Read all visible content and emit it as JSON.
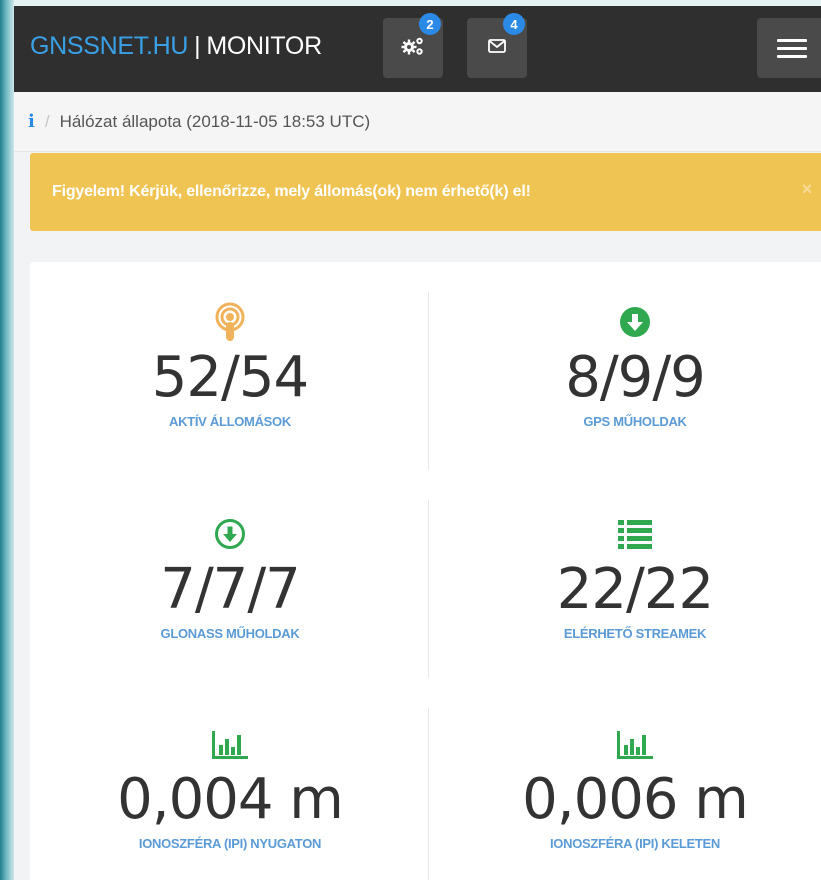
{
  "header": {
    "site": "GNSSNET.HU",
    "separator": "|",
    "app_name": "MONITOR",
    "tasks_badge": "2",
    "mail_badge": "4"
  },
  "breadcrumb": {
    "info_glyph": "i",
    "slash": "/",
    "page": "Hálózat állapota (2018-11-05 18:53 UTC)"
  },
  "alert": {
    "text": "Figyelem! Kérjük, ellenőrizze, mely állomás(ok) nem érhető(k) el!",
    "close": "×"
  },
  "stats": [
    {
      "value": "52/54",
      "label": "AKTÍV ÁLLOMÁSOK",
      "icon": "podcast-icon",
      "icon_color": "#f0b35b"
    },
    {
      "value": "8/9/9",
      "label": "GPS MŰHOLDAK",
      "icon": "arrow-circle-down-icon",
      "icon_color": "#2fa84f"
    },
    {
      "value": "7/7/7",
      "label": "GLONASS MŰHOLDAK",
      "icon": "arrow-circle-down-outline-icon",
      "icon_color": "#2fa84f"
    },
    {
      "value": "22/22",
      "label": "ELÉRHETŐ STREAMEK",
      "icon": "list-icon",
      "icon_color": "#2fa84f"
    },
    {
      "value": "0,004 m",
      "label": "IONOSZFÉRA (IPI) NYUGATON",
      "icon": "bar-chart-icon",
      "icon_color": "#2fa84f"
    },
    {
      "value": "0,006 m",
      "label": "IONOSZFÉRA (IPI) KELETEN",
      "icon": "bar-chart-icon",
      "icon_color": "#2fa84f"
    }
  ],
  "colors": {
    "topbar": "#2f2f2f",
    "brand_blue": "#3aa0e6",
    "badge": "#2b8ae6",
    "alert": "#f0c452",
    "label_blue": "#5b9bd5",
    "green": "#2fa84f",
    "orange": "#f0b35b"
  }
}
